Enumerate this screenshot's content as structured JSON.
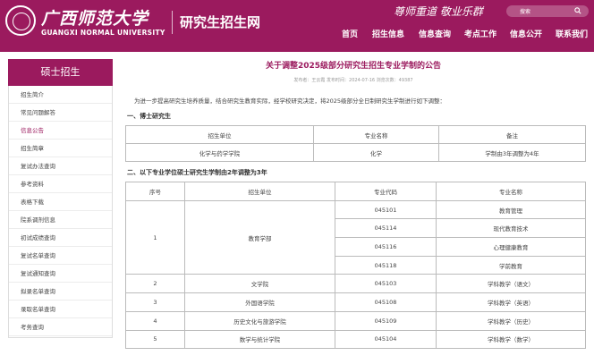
{
  "header": {
    "logo_cn": "广西师范大学",
    "logo_en": "GUANGXI NORMAL UNIVERSITY",
    "site_title": "研究生招生网",
    "slogan": "尊师重道 敬业乐群",
    "search_label": "搜索",
    "nav": [
      "首页",
      "招生信息",
      "信息查询",
      "考点工作",
      "信息公开",
      "联系我们"
    ],
    "brand_color": "#9b1a5e"
  },
  "sidebar": {
    "title": "硕士招生",
    "items": [
      {
        "label": "招生简介",
        "active": false
      },
      {
        "label": "常见问题解答",
        "active": false
      },
      {
        "label": "信息公告",
        "active": true
      },
      {
        "label": "招生简章",
        "active": false
      },
      {
        "label": "复试办法查询",
        "active": false
      },
      {
        "label": "参考资料",
        "active": false
      },
      {
        "label": "表格下载",
        "active": false
      },
      {
        "label": "院系调剂信息",
        "active": false
      },
      {
        "label": "初试成绩查询",
        "active": false
      },
      {
        "label": "复试名单查询",
        "active": false
      },
      {
        "label": "复试通知查询",
        "active": false
      },
      {
        "label": "拟录名单查询",
        "active": false
      },
      {
        "label": "录取名单查询",
        "active": false
      },
      {
        "label": "考务查询",
        "active": false
      }
    ]
  },
  "article": {
    "title": "关于调整2025级部分研究生招生专业学制的公告",
    "meta": "发布者：王云霞   发布时间：2024-07-16   浏览次数：49387",
    "intro": "为进一步提高研究生培养质量，结合研究生教育实际，经学校研究决定，将2025级部分全日制研究生学制进行如下调整：",
    "section1": "一、博士研究生",
    "table1": {
      "headers": [
        "招生单位",
        "专业名称",
        "备注"
      ],
      "rows": [
        [
          "化学与药学学院",
          "化学",
          "学制由3年调整为4年"
        ]
      ]
    },
    "section2": "二、以下专业学位硕士研究生学制由2年调整为3年",
    "table2": {
      "headers": [
        "序号",
        "招生单位",
        "专业代码",
        "专业名称"
      ],
      "groups": [
        {
          "no": "1",
          "unit": "教育学部",
          "rows": [
            [
              "045101",
              "教育管理"
            ],
            [
              "045114",
              "现代教育技术"
            ],
            [
              "045116",
              "心理健康教育"
            ],
            [
              "045118",
              "学前教育"
            ]
          ]
        },
        {
          "no": "2",
          "unit": "文学院",
          "rows": [
            [
              "045103",
              "学科教学（语文）"
            ]
          ]
        },
        {
          "no": "3",
          "unit": "外国语学院",
          "rows": [
            [
              "045108",
              "学科教学（英语）"
            ]
          ]
        },
        {
          "no": "4",
          "unit": "历史文化与旅游学院",
          "rows": [
            [
              "045109",
              "学科教学（历史）"
            ]
          ]
        },
        {
          "no": "5",
          "unit": "数学与统计学院",
          "rows": [
            [
              "045104",
              "学科教学（数学）"
            ]
          ]
        }
      ]
    }
  }
}
